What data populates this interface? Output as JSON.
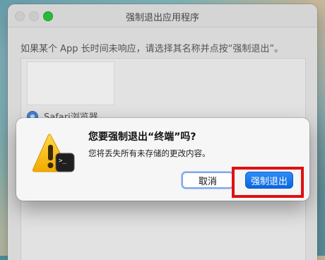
{
  "window": {
    "title": "强制退出应用程序",
    "instruction": "如果某个 App 长时间未响应，请选择其名称并点按“强制退出”。",
    "apps": [
      {
        "name": "Safari浏览器",
        "icon": "safari-icon"
      }
    ]
  },
  "dialog": {
    "title": "您要强制退出“终端”吗?",
    "message": "您将丢失所有未存储的更改内容。",
    "icon": "warning-terminal-icon",
    "cancel_label": "取消",
    "force_quit_label": "强制退出"
  },
  "annotation": {
    "highlight_color": "#e01010",
    "target": "force-quit-button"
  },
  "colors": {
    "accent": "#0a66e0",
    "traffic_zoom": "#2ec440"
  }
}
